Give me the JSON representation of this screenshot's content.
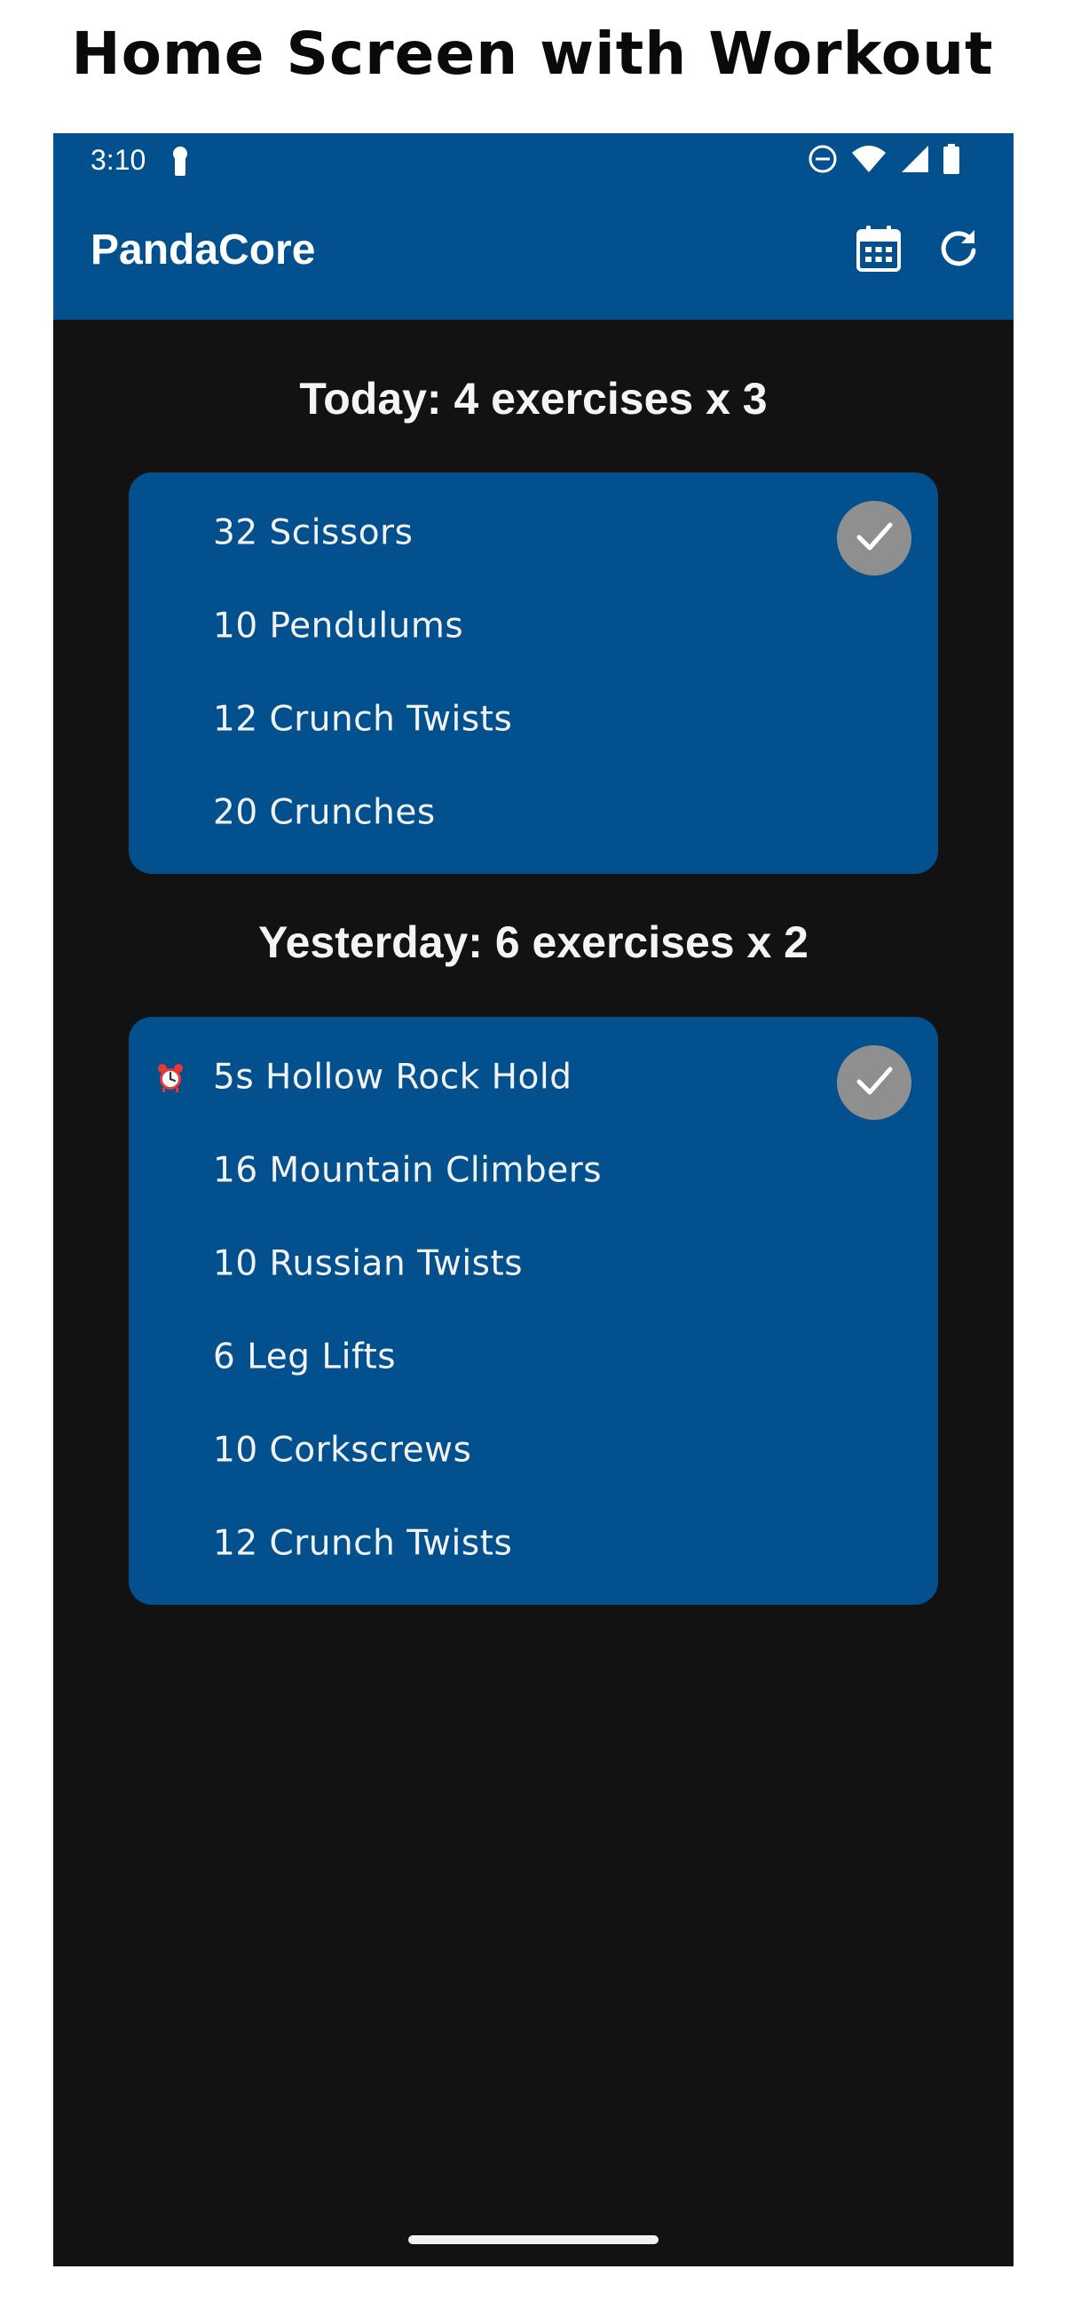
{
  "caption": "Home Screen with Workout",
  "status_bar": {
    "time": "3:10",
    "icons": [
      "lock-icon",
      "do-not-disturb-icon",
      "wifi-icon",
      "signal-icon",
      "battery-icon"
    ]
  },
  "app_bar": {
    "title": "PandaCore",
    "actions": [
      {
        "icon": "calendar-icon"
      },
      {
        "icon": "refresh-icon"
      }
    ],
    "color": "#03508f"
  },
  "workouts": [
    {
      "heading": "Today: 4 exercises x 3",
      "completed": true,
      "exercises": [
        {
          "label": "32 Scissors",
          "timed": false
        },
        {
          "label": "10 Pendulums",
          "timed": false
        },
        {
          "label": "12 Crunch Twists",
          "timed": false
        },
        {
          "label": "20 Crunches",
          "timed": false
        }
      ]
    },
    {
      "heading": "Yesterday: 6 exercises x 2",
      "completed": true,
      "exercises": [
        {
          "label": "5s Hollow Rock Hold",
          "timed": true
        },
        {
          "label": "16 Mountain Climbers",
          "timed": false
        },
        {
          "label": "10 Russian Twists",
          "timed": false
        },
        {
          "label": "6 Leg Lifts",
          "timed": false
        },
        {
          "label": "10 Corkscrews",
          "timed": false
        },
        {
          "label": "12 Crunch Twists",
          "timed": false
        }
      ]
    }
  ],
  "colors": {
    "background": "#121212",
    "card": "#03508f",
    "check_button": "#8f8f8f",
    "alarm": "#e53935"
  }
}
